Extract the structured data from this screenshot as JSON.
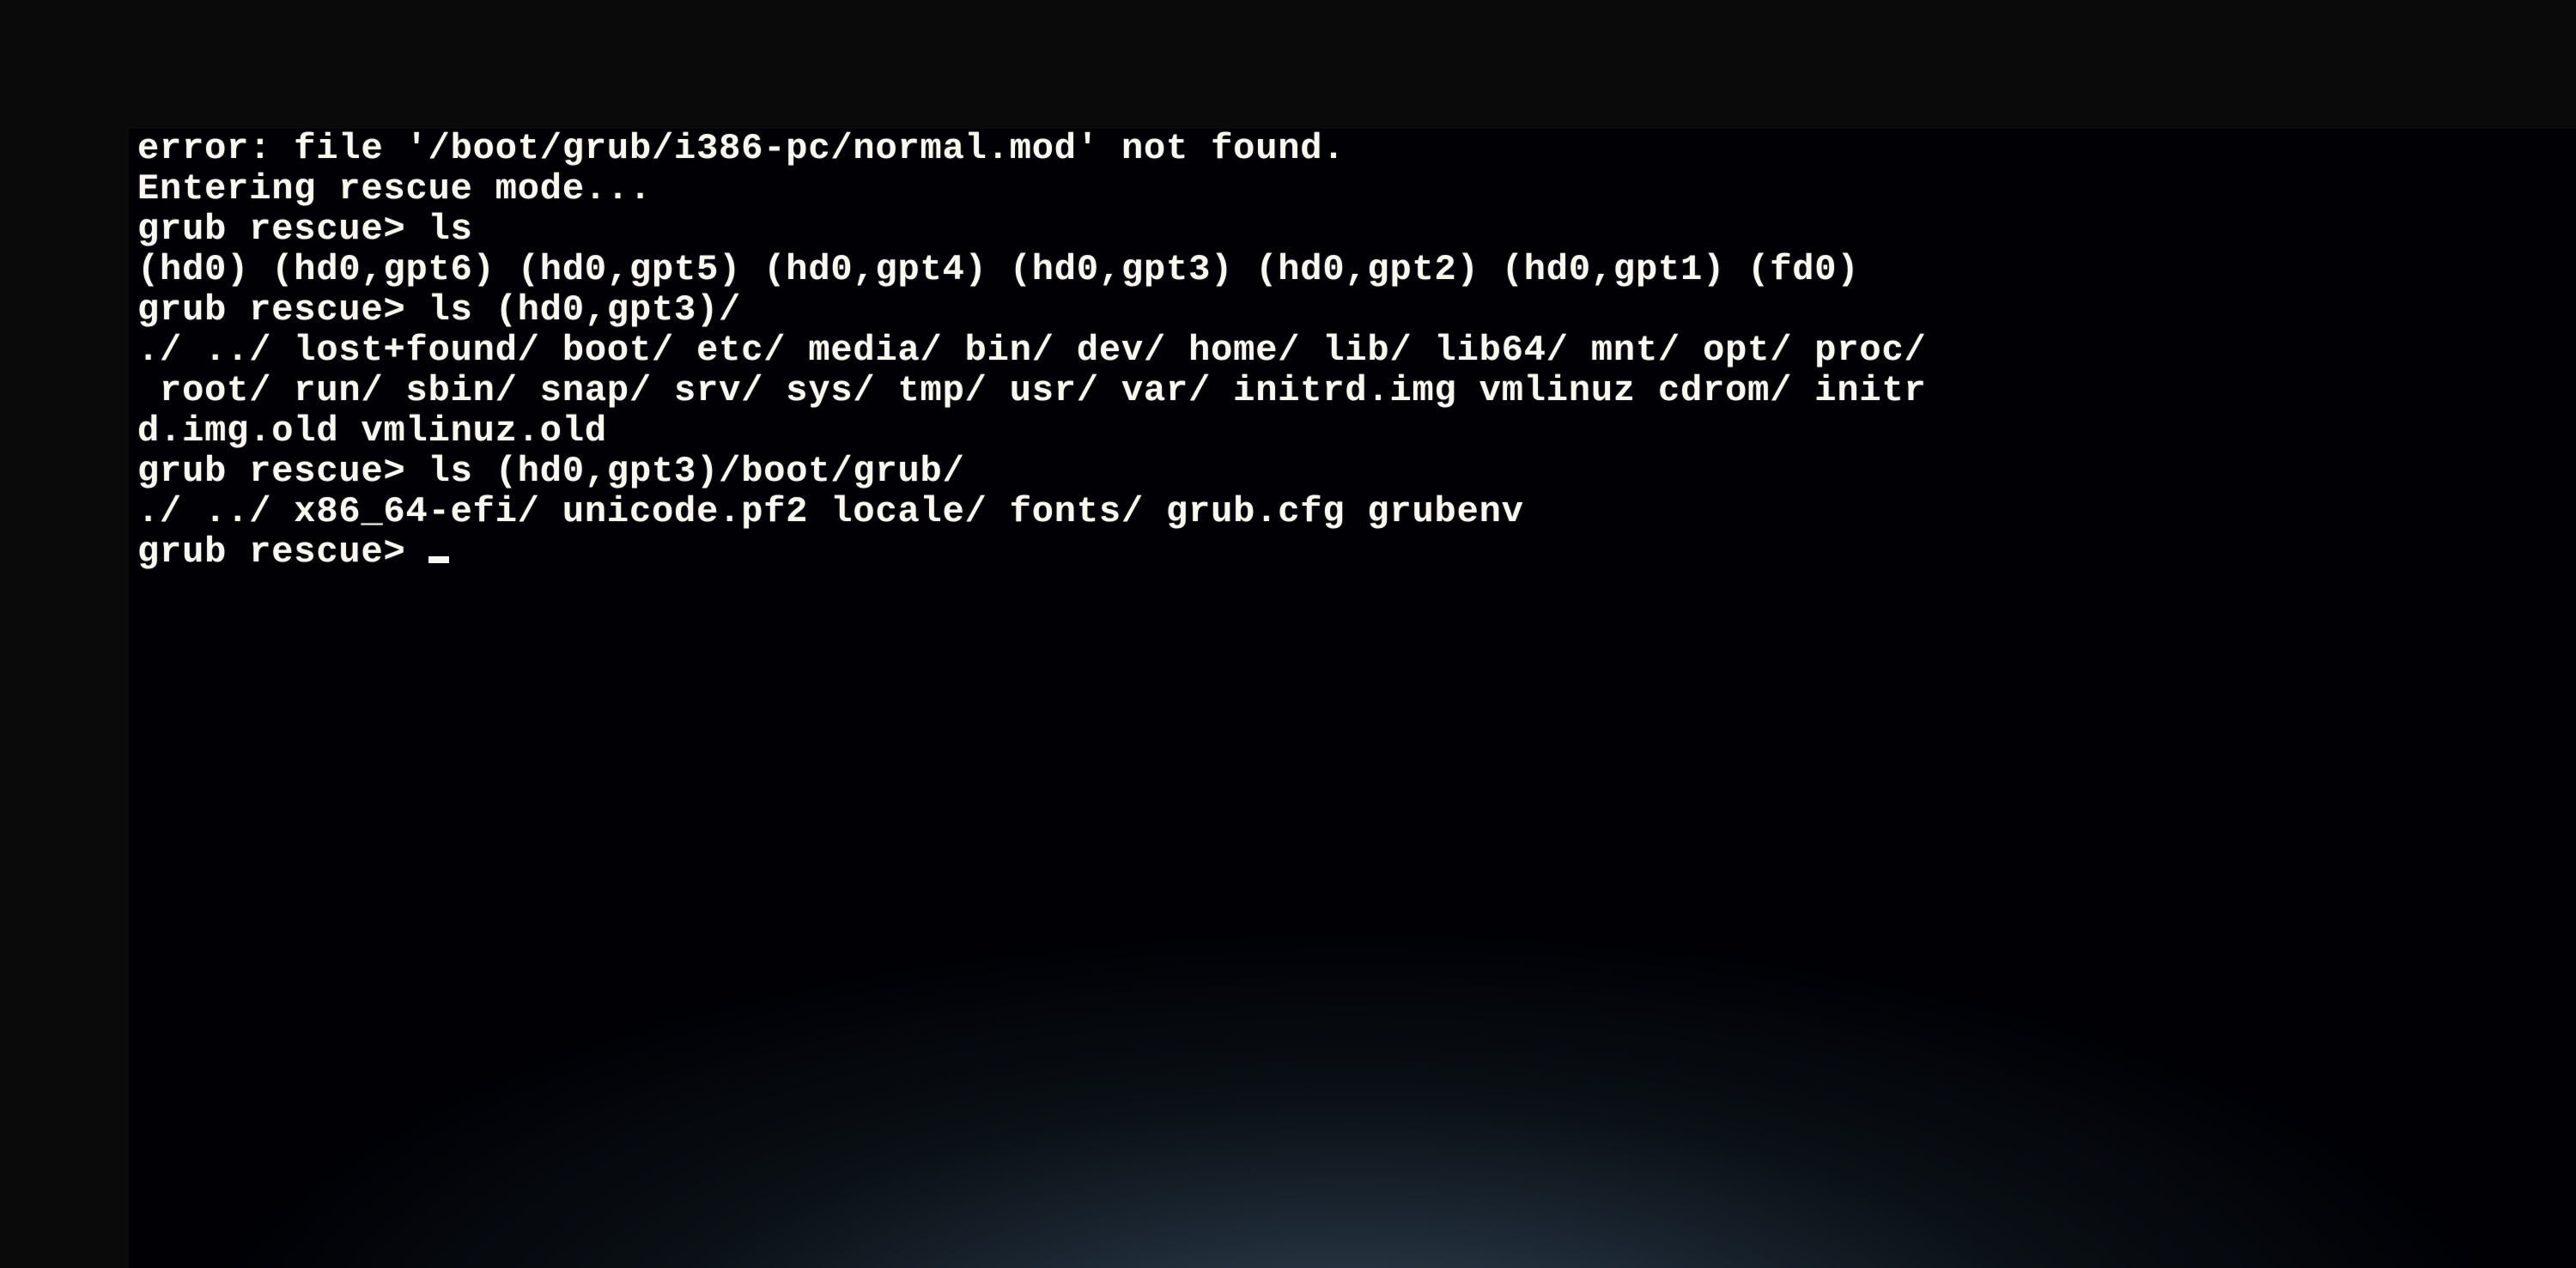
{
  "terminal": {
    "lines": [
      "error: file '/boot/grub/i386-pc/normal.mod' not found.",
      "Entering rescue mode...",
      "grub rescue> ls",
      "(hd0) (hd0,gpt6) (hd0,gpt5) (hd0,gpt4) (hd0,gpt3) (hd0,gpt2) (hd0,gpt1) (fd0)",
      "grub rescue> ls (hd0,gpt3)/",
      "./ ../ lost+found/ boot/ etc/ media/ bin/ dev/ home/ lib/ lib64/ mnt/ opt/ proc/",
      " root/ run/ sbin/ snap/ srv/ sys/ tmp/ usr/ var/ initrd.img vmlinuz cdrom/ initr",
      "d.img.old vmlinuz.old",
      "grub rescue> ls (hd0,gpt3)/boot/grub/",
      "./ ../ x86_64-efi/ unicode.pf2 locale/ fonts/ grub.cfg grubenv"
    ],
    "prompt": "grub rescue> "
  }
}
